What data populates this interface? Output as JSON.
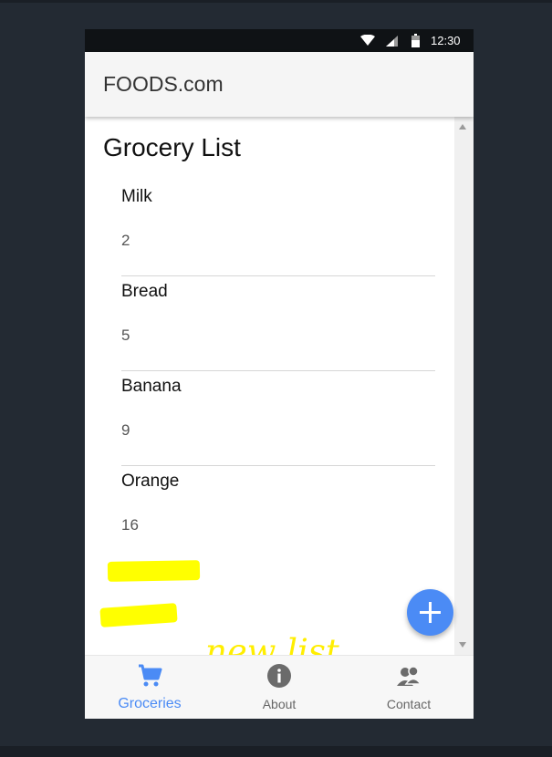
{
  "statusbar": {
    "time": "12:30",
    "wifi_icon": "wifi-icon",
    "signal_icon": "cell-signal-icon",
    "battery_icon": "battery-icon"
  },
  "appbar": {
    "title": "FOODS.com"
  },
  "page": {
    "title": "Grocery List"
  },
  "groceries": [
    {
      "name": "Milk",
      "quantity": "2"
    },
    {
      "name": "Bread",
      "quantity": "5"
    },
    {
      "name": "Banana",
      "quantity": "9"
    },
    {
      "name": "Orange",
      "quantity": "16"
    }
  ],
  "annotation": {
    "text": "new list",
    "color": "#ffee00"
  },
  "fab": {
    "icon": "plus-icon"
  },
  "bottom_nav": [
    {
      "label": "Groceries",
      "icon": "cart-icon",
      "active": true
    },
    {
      "label": "About",
      "icon": "info-icon",
      "active": false
    },
    {
      "label": "Contact",
      "icon": "contacts-icon",
      "active": false
    }
  ],
  "colors": {
    "accent": "#4b8bf5",
    "highlight": "#ffff00",
    "background": "#232a33"
  }
}
